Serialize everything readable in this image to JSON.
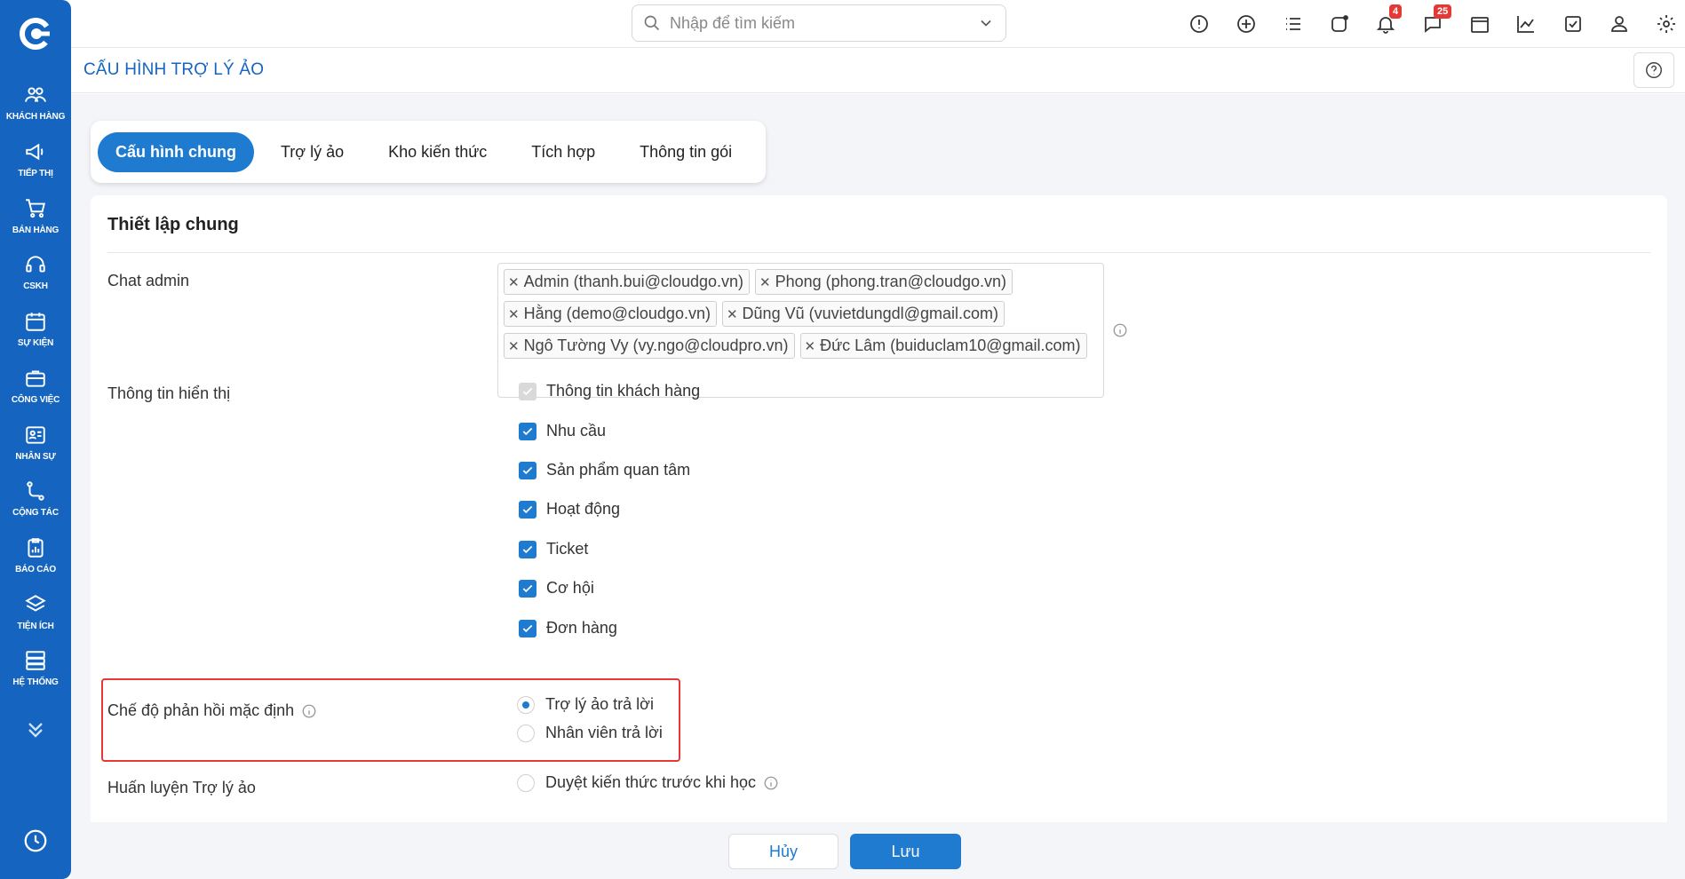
{
  "sidebar": {
    "items": [
      {
        "label": "KHÁCH HÀNG",
        "icon": "users-icon"
      },
      {
        "label": "TIẾP THỊ",
        "icon": "megaphone-icon"
      },
      {
        "label": "BÁN HÀNG",
        "icon": "cart-icon"
      },
      {
        "label": "CSKH",
        "icon": "headset-icon"
      },
      {
        "label": "SỰ KIỆN",
        "icon": "calendar-icon"
      },
      {
        "label": "CÔNG VIỆC",
        "icon": "briefcase-icon"
      },
      {
        "label": "NHÂN SỰ",
        "icon": "id-card-icon"
      },
      {
        "label": "CỘNG TÁC",
        "icon": "collab-icon"
      },
      {
        "label": "BÁO CÁO",
        "icon": "report-icon"
      },
      {
        "label": "TIỆN ÍCH",
        "icon": "layers-icon"
      },
      {
        "label": "HỆ THỐNG",
        "icon": "server-icon"
      }
    ]
  },
  "topbar": {
    "search_placeholder": "Nhập để tìm kiếm",
    "notification_count": "4",
    "message_count": "25"
  },
  "page": {
    "title": "CẤU HÌNH TRỢ LÝ ẢO"
  },
  "tabs": [
    {
      "label": "Cấu hình chung",
      "active": true
    },
    {
      "label": "Trợ lý ảo",
      "active": false
    },
    {
      "label": "Kho kiến thức",
      "active": false
    },
    {
      "label": "Tích hợp",
      "active": false
    },
    {
      "label": "Thông tin gói",
      "active": false
    }
  ],
  "general": {
    "section_title": "Thiết lập chung",
    "chat_admin_label": "Chat admin",
    "chat_admins": [
      "Admin (thanh.bui@cloudgo.vn)",
      "Phong (phong.tran@cloudgo.vn)",
      "Hằng (demo@cloudgo.vn)",
      "Dũng Vũ (vuvietdungdl@gmail.com)",
      "Ngô Tường Vy (vy.ngo@cloudpro.vn)",
      "Đức Lâm (buiduclam10@gmail.com)"
    ],
    "display_info_label": "Thông tin hiển thị",
    "display_options": [
      {
        "label": "Thông tin khách hàng",
        "checked": true,
        "disabled": true
      },
      {
        "label": "Nhu cầu",
        "checked": true,
        "disabled": false
      },
      {
        "label": "Sản phẩm quan tâm",
        "checked": true,
        "disabled": false
      },
      {
        "label": "Hoạt động",
        "checked": true,
        "disabled": false
      },
      {
        "label": "Ticket",
        "checked": true,
        "disabled": false
      },
      {
        "label": "Cơ hội",
        "checked": true,
        "disabled": false
      },
      {
        "label": "Đơn hàng",
        "checked": true,
        "disabled": false
      }
    ],
    "reply_mode_label": "Chế độ phản hồi mặc định",
    "reply_modes": [
      {
        "label": "Trợ lý ảo trả lời",
        "selected": true
      },
      {
        "label": "Nhân viên trả lời",
        "selected": false
      }
    ],
    "training_label": "Huấn luyện Trợ lý ảo",
    "training_option": "Duyệt kiến thức trước khi học"
  },
  "footer": {
    "cancel_label": "Hủy",
    "save_label": "Lưu"
  },
  "colors": {
    "brand": "#1565c0",
    "accent": "#1e7bd0",
    "badge": "#e53935",
    "highlight": "#e53935"
  }
}
